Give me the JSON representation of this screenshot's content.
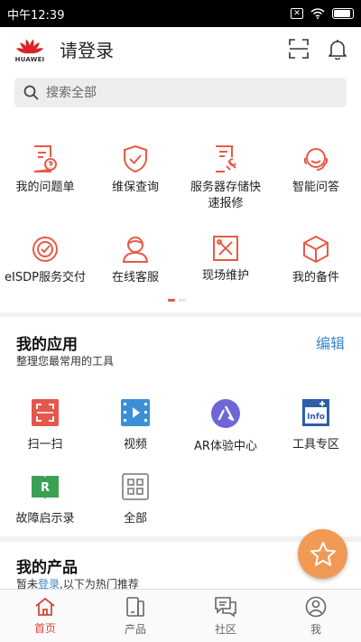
{
  "status_bar": {
    "time": "中午12:39",
    "battery_level": 0.9
  },
  "header": {
    "logo_text": "HUAWEI",
    "title": "请登录",
    "scan_icon": "scan-frame-icon",
    "bell_icon": "bell-icon"
  },
  "search": {
    "placeholder": "搜索全部"
  },
  "services": [
    {
      "label": "我的问题单",
      "icon": "issue-ticket-icon"
    },
    {
      "label": "维保查询",
      "icon": "shield-check-icon"
    },
    {
      "label": "服务器存储快速报修",
      "icon": "repair-doc-icon"
    },
    {
      "label": "智能问答",
      "icon": "headset-icon"
    },
    {
      "label": "eISDP服务交付",
      "icon": "delivery-check-icon"
    },
    {
      "label": "在线客服",
      "icon": "agent-icon"
    },
    {
      "label": "现场维护",
      "icon": "tools-icon"
    },
    {
      "label": "我的备件",
      "icon": "box-icon"
    }
  ],
  "my_apps": {
    "title": "我的应用",
    "subtitle": "整理您最常用的工具",
    "edit_label": "编辑",
    "items": [
      {
        "label": "扫一扫",
        "icon": "scan-icon",
        "color": "#e5574b"
      },
      {
        "label": "视频",
        "icon": "video-icon",
        "color": "#3c8fd6"
      },
      {
        "label": "AR体验中心",
        "icon": "ar-icon",
        "color": "#6f67d6"
      },
      {
        "label": "工具专区",
        "icon": "info-tools-icon",
        "color": "#2d5fa8"
      },
      {
        "label": "故障启示录",
        "icon": "book-icon",
        "color": "#3aa154"
      },
      {
        "label": "全部",
        "icon": "grid-icon",
        "color": "#888888"
      }
    ]
  },
  "my_products": {
    "title": "我的产品",
    "sub_prefix": "暂未",
    "sub_login": "登录",
    "sub_suffix": ",以下为热门推荐"
  },
  "fab": {
    "icon": "star-icon",
    "color": "#f19a55"
  },
  "tabs": [
    {
      "label": "首页",
      "icon": "home-icon",
      "active": true
    },
    {
      "label": "产品",
      "icon": "product-phone-icon",
      "active": false
    },
    {
      "label": "社区",
      "icon": "community-icon",
      "active": false
    },
    {
      "label": "我",
      "icon": "profile-icon",
      "active": false
    }
  ],
  "colors": {
    "accent": "#e85a45",
    "link": "#3a86c8",
    "active_tab": "#d9453a"
  }
}
